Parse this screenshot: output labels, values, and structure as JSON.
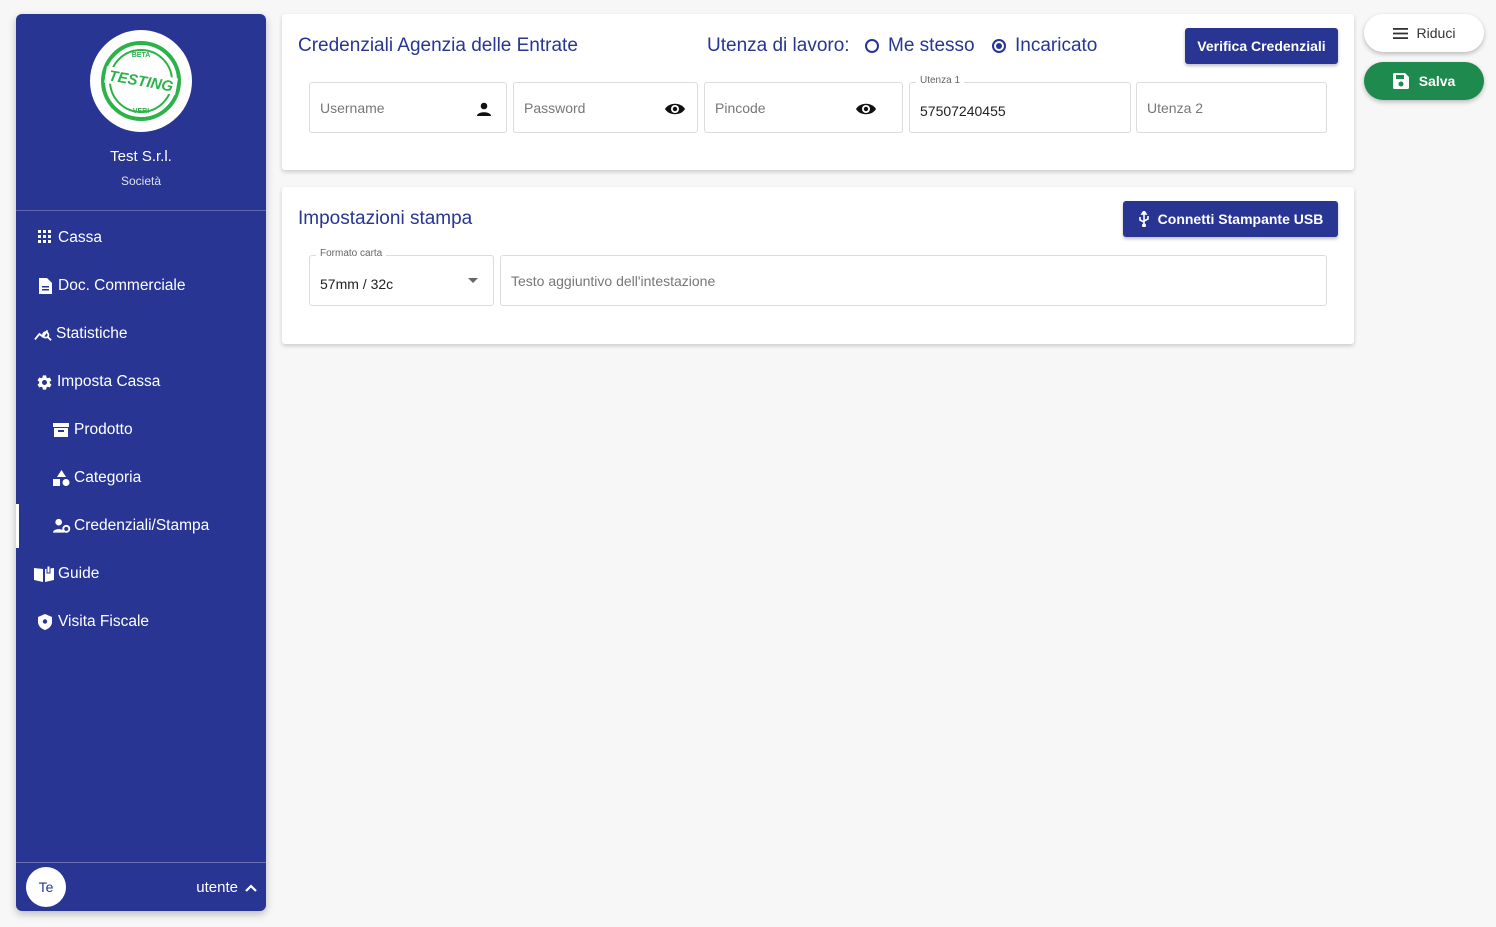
{
  "sidebar": {
    "logo_text": {
      "top": "BETA",
      "middle": "TESTING",
      "bottom": "VERI"
    },
    "company_name": "Test S.r.l.",
    "company_type": "Società",
    "items": [
      {
        "label": "Cassa",
        "icon": "keypad-icon"
      },
      {
        "label": "Doc. Commerciale",
        "icon": "document-icon"
      },
      {
        "label": "Statistiche",
        "icon": "chart-search-icon"
      },
      {
        "label": "Imposta Cassa",
        "icon": "gear-icon"
      },
      {
        "label": "Prodotto",
        "icon": "archive-icon"
      },
      {
        "label": "Categoria",
        "icon": "shapes-icon"
      },
      {
        "label": "Credenziali/Stampa",
        "icon": "account-cog-icon"
      },
      {
        "label": "Guide",
        "icon": "book-icon"
      },
      {
        "label": "Visita Fiscale",
        "icon": "shield-icon"
      }
    ],
    "user": {
      "avatar": "Te",
      "name": "utente"
    }
  },
  "credentials": {
    "title": "Credenziali Agenzia delle Entrate",
    "work_user_label": "Utenza di lavoro:",
    "option_self": "Me stesso",
    "option_delegate": "Incaricato",
    "selected_option": "Incaricato",
    "verify_button": "Verifica Credenziali",
    "username_placeholder": "Username",
    "password_placeholder": "Password",
    "pincode_placeholder": "Pincode",
    "utenza1_label": "Utenza 1",
    "utenza1_value": "57507240455",
    "utenza2_placeholder": "Utenza 2"
  },
  "print": {
    "title": "Impostazioni stampa",
    "connect_button": "Connetti Stampante USB",
    "paper_label": "Formato carta",
    "paper_value": "57mm / 32c",
    "header_text_placeholder": "Testo aggiuntivo dell'intestazione"
  },
  "actions": {
    "riduci": "Riduci",
    "salva": "Salva"
  },
  "colors": {
    "primary": "#283593",
    "success": "#1e8a4e",
    "logo_green": "#2bb34a"
  }
}
